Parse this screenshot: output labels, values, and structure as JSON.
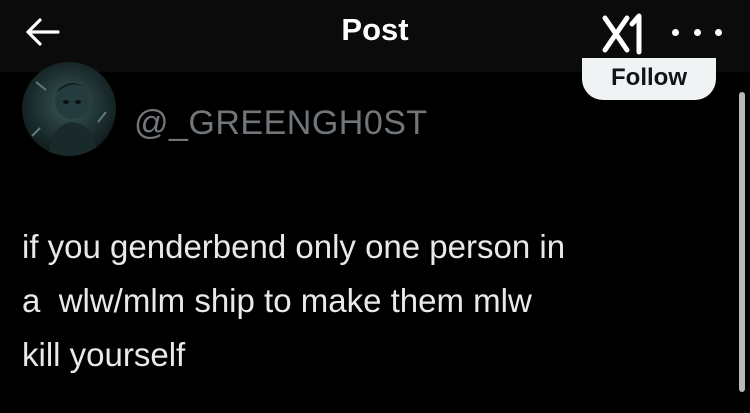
{
  "header": {
    "title": "Post",
    "back_icon": "arrow-left-icon",
    "logo_icon": "xl-logo-icon",
    "more_icon": "more-dots-icon"
  },
  "author": {
    "handle": "@_GREENGH0ST",
    "follow_label": "Follow"
  },
  "tweet": {
    "lines": [
      "if you genderbend only one person in",
      "a  wlw/mlm ship to make them mlw",
      "kill yourself"
    ]
  },
  "colors": {
    "background": "#000000",
    "text": "#e7e9ea",
    "secondary_text": "#71767b",
    "follow_bg": "#eff3f4"
  }
}
